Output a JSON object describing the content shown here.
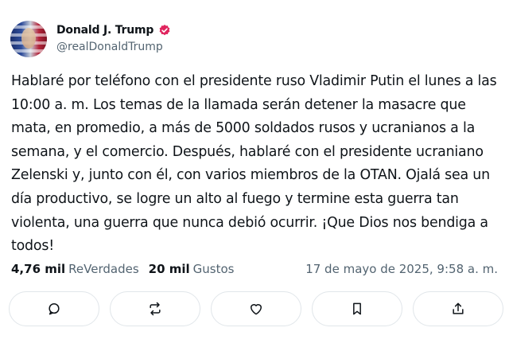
{
  "author": {
    "name": "Donald J. Trump",
    "handle": "@realDonaldTrump",
    "verified_badge_icon": "verified-badge-icon",
    "badge_color": "#e0245e"
  },
  "tweet": {
    "text": "Hablaré por teléfono con el presidente ruso Vladimir Putin el lunes a las 10:00 a. m. Los temas de la llamada serán detener la masacre que mata, en promedio, a más de 5000 soldados rusos y ucranianos a la semana, y el comercio. Después, hablaré con el presidente ucraniano Zelenski y, junto con él, con varios miembros de la OTAN. Ojalá sea un día productivo, se logre un alto al fuego y termine esta guerra tan violenta, una guerra que nunca debió ocurrir. ¡Que Dios nos bendiga a todos!"
  },
  "stats": {
    "reposts_count": "4,76 mil",
    "reposts_label": "ReVerdades",
    "likes_count": "20 mil",
    "likes_label": "Gustos",
    "timestamp": "17 de mayo de 2025, 9:58 a. m."
  },
  "actions": [
    {
      "icon": "reply-icon"
    },
    {
      "icon": "repost-icon"
    },
    {
      "icon": "like-icon"
    },
    {
      "icon": "bookmark-icon"
    },
    {
      "icon": "share-icon"
    }
  ],
  "colors": {
    "text_primary": "#0f1419",
    "text_secondary": "#536471",
    "border": "#e1e6ea"
  }
}
